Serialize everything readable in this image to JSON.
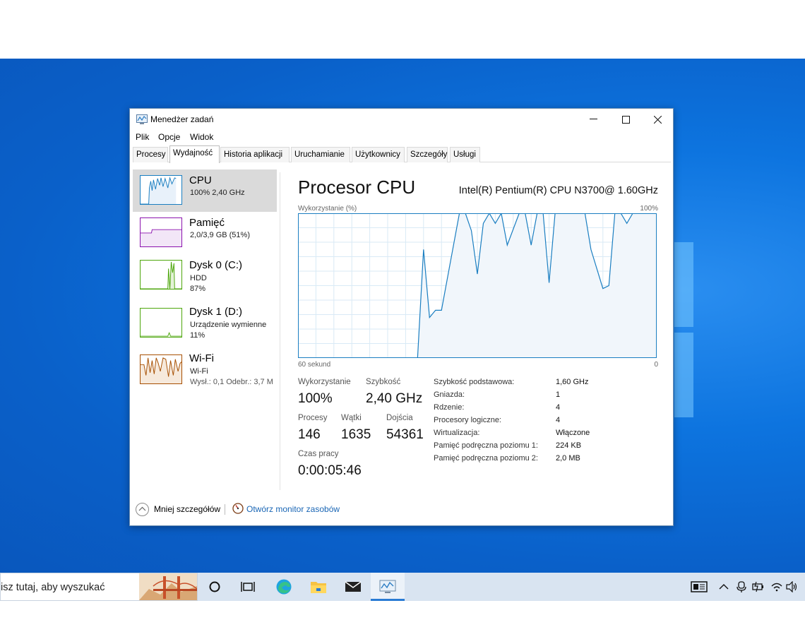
{
  "window": {
    "title": "Menedżer zadań",
    "controls": {
      "minimize": "—",
      "maximize": "☐",
      "close": "✕"
    }
  },
  "menu": [
    "Plik",
    "Opcje",
    "Widok"
  ],
  "tabs": [
    "Procesy",
    "Wydajność",
    "Historia aplikacji",
    "Uruchamianie",
    "Użytkownicy",
    "Szczegóły",
    "Usługi"
  ],
  "active_tab": "Wydajność",
  "sidebar": [
    {
      "name": "CPU",
      "lines": [
        "100% 2,40 GHz"
      ],
      "color": "#1a7ec1",
      "selected": true
    },
    {
      "name": "Pamięć",
      "lines": [
        "2,0/3,9 GB (51%)"
      ],
      "color": "#8b12ae",
      "selected": false
    },
    {
      "name": "Dysk 0 (C:)",
      "lines": [
        "HDD",
        "87%"
      ],
      "color": "#4da60c",
      "selected": false
    },
    {
      "name": "Dysk 1 (D:)",
      "lines": [
        "Urządzenie wymienne",
        "11%"
      ],
      "color": "#4da60c",
      "selected": false
    },
    {
      "name": "Wi-Fi",
      "lines": [
        "Wi-Fi",
        "Wysł.: 0,1  Odebr.: 3,7 M"
      ],
      "color": "#a74f01",
      "selected": false
    }
  ],
  "main": {
    "heading": "Procesor CPU",
    "cpu_model": "Intel(R) Pentium(R) CPU N3700@ 1.60GHz",
    "graph_label_left": "Wykorzystanie (%)",
    "graph_label_right": "100%",
    "graph_foot_left": "60 sekund",
    "graph_foot_right": "0",
    "graph_color": "#1a7ec1",
    "graph_fill": "#f1f6fb",
    "graph_grid": "#d9eaf6",
    "utilization_label": "Wykorzystanie",
    "utilization": "100%",
    "speed_label": "Szybkość",
    "speed": "2,40 GHz",
    "processes_label": "Procesy",
    "processes": "146",
    "threads_label": "Wątki",
    "threads": "1635",
    "handles_label": "Dojścia",
    "handles": "54361",
    "uptime_label": "Czas pracy",
    "uptime": "0:00:05:46",
    "details": [
      {
        "label": "Szybkość podstawowa:",
        "value": "1,60 GHz"
      },
      {
        "label": "Gniazda:",
        "value": "1"
      },
      {
        "label": "Rdzenie:",
        "value": "4"
      },
      {
        "label": "Procesory logiczne:",
        "value": "4"
      },
      {
        "label": "Wirtualizacja:",
        "value": "Włączone"
      },
      {
        "label": "Pamięć podręczna poziomu 1:",
        "value": "224 KB"
      },
      {
        "label": "Pamięć podręczna poziomu 2:",
        "value": "2,0 MB"
      }
    ]
  },
  "footer": {
    "fewer_details": "Mniej szczegółów",
    "resource_monitor": "Otwórz monitor zasobów"
  },
  "taskbar": {
    "search_placeholder": "isz tutaj, aby wyszukać",
    "icons": [
      "cortana-icon",
      "task-view-icon",
      "edge-icon",
      "file-explorer-icon",
      "mail-icon",
      "task-manager-icon"
    ],
    "tray_icons": [
      "news-icon",
      "chevron-up-icon",
      "meet-icon",
      "battery-icon",
      "wifi-icon",
      "volume-icon"
    ]
  },
  "chart_data": {
    "type": "area",
    "title": "Wykorzystanie (%)",
    "xlabel": "60 sekund",
    "ylabel": "",
    "xlim": [
      60,
      0
    ],
    "ylim": [
      0,
      100
    ],
    "grid": true,
    "x": [
      60,
      40,
      39,
      38,
      37,
      36,
      33,
      32,
      31,
      30,
      29,
      28,
      27,
      26,
      25,
      23,
      22,
      21,
      20,
      19,
      18,
      17,
      15,
      14,
      13,
      12,
      11,
      9,
      8,
      7,
      6,
      5,
      4,
      3,
      0
    ],
    "values": [
      0,
      0,
      75,
      28,
      33,
      33,
      100,
      100,
      88,
      58,
      93,
      100,
      93,
      100,
      78,
      100,
      100,
      78,
      100,
      100,
      52,
      100,
      100,
      100,
      100,
      100,
      75,
      48,
      50,
      100,
      100,
      93,
      100,
      100,
      100
    ]
  }
}
